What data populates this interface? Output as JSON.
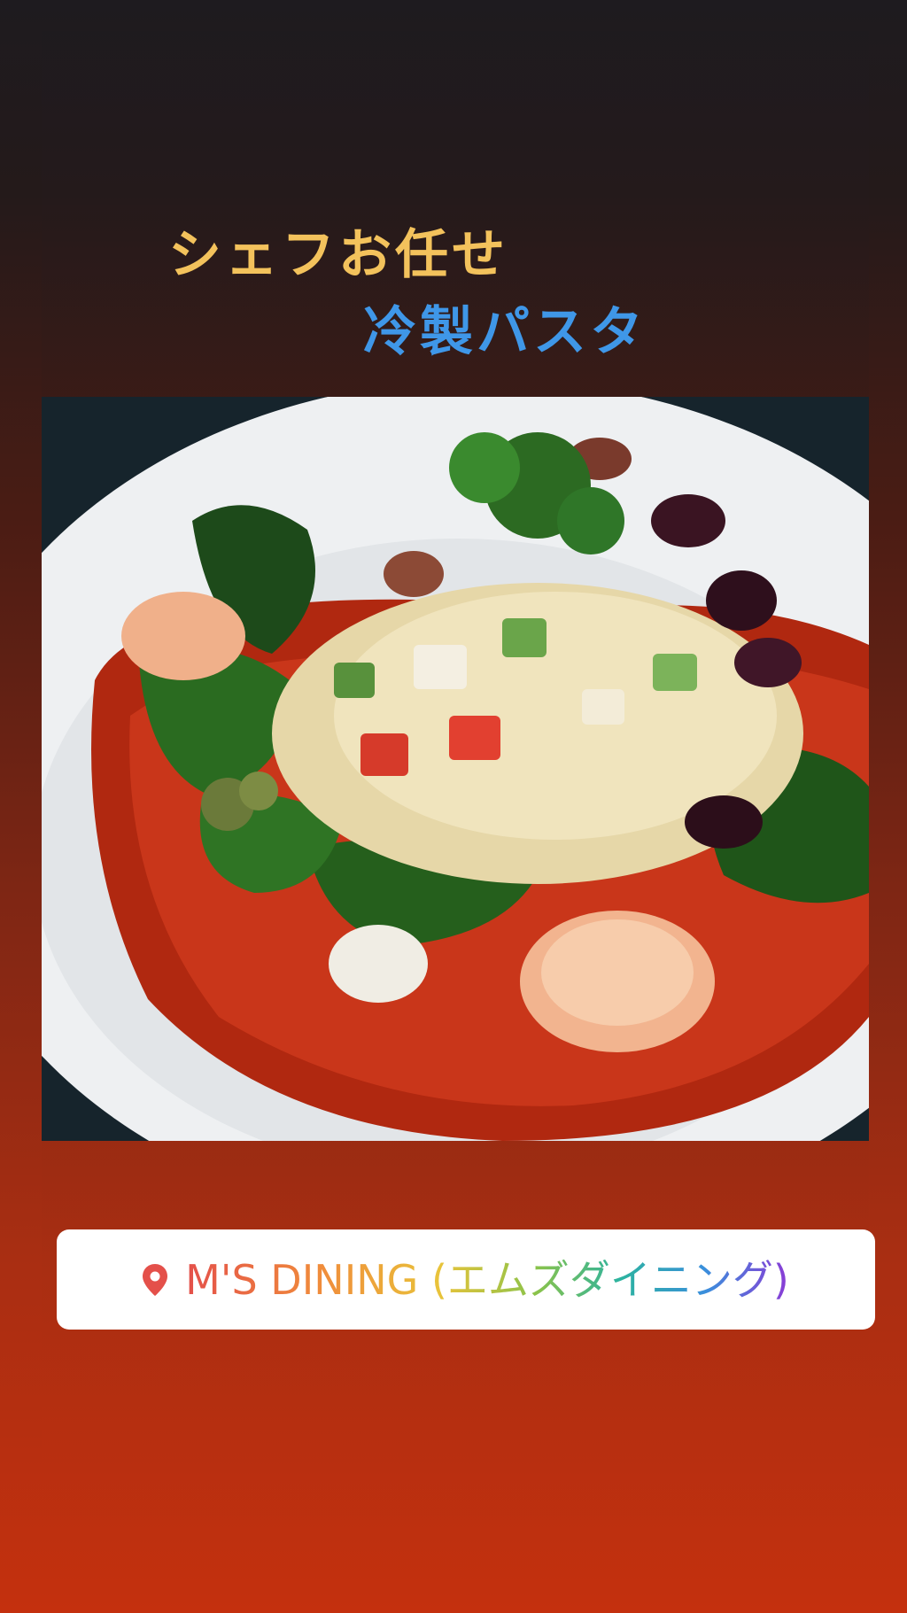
{
  "story": {
    "title_line1": "シェフお任せ",
    "title_line2": "冷製パスタ",
    "title_colors": {
      "line1": "#f3c25c",
      "line2": "#3f97e8"
    }
  },
  "photo": {
    "description_icon": "plated-pasta-photo"
  },
  "location_sticker": {
    "icon": "map-pin-icon",
    "label": "M'S DINING (エムズダイニング)"
  }
}
